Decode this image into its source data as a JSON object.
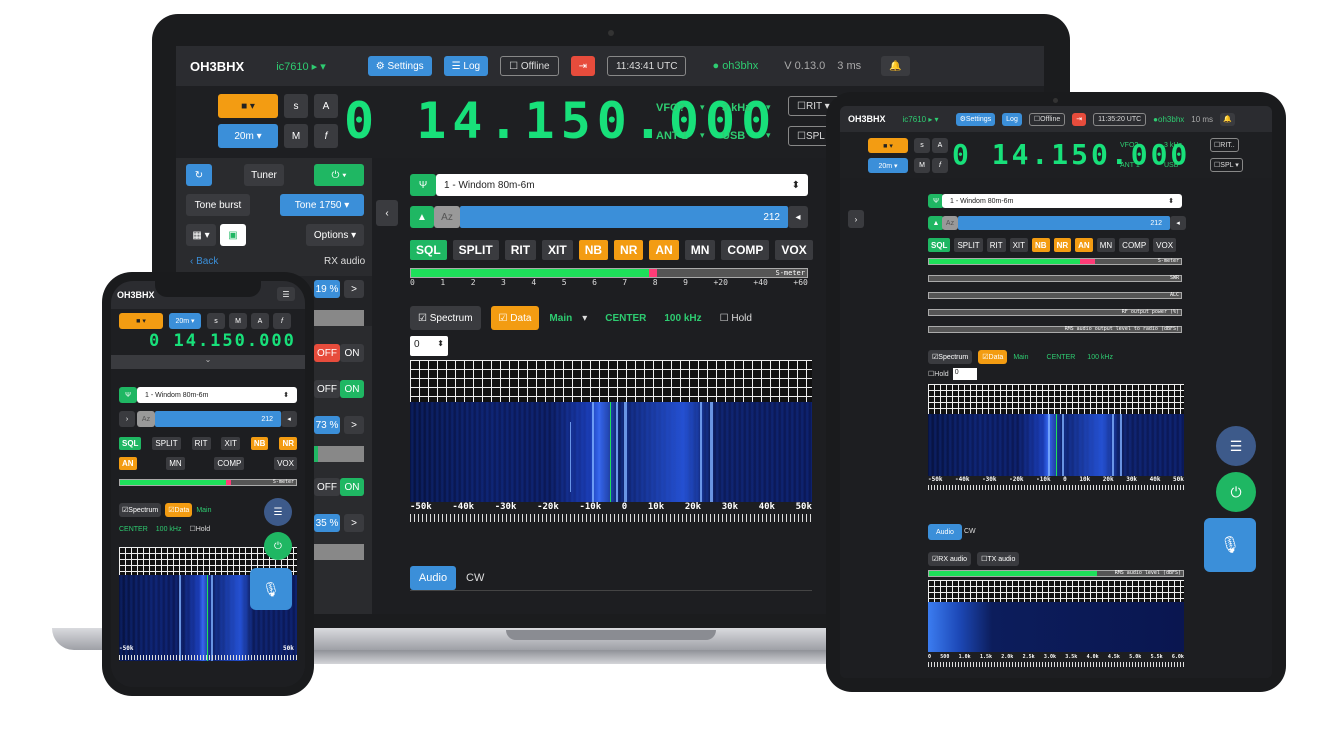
{
  "laptop": {
    "topbar": {
      "brand": "OH3BHX",
      "radio": "ic7610 ▸ ▾",
      "settings": "Settings",
      "log": "Log",
      "offline": "Offline",
      "logout_icon": "sign-out-icon",
      "time": "11:43:41 UTC",
      "user": "oh3bhx",
      "version": "V 0.13.0",
      "latency": "3 ms"
    },
    "freqrow": {
      "a_label": "A",
      "s_label": "s",
      "m_label": "M",
      "f_label": "f",
      "band": "20m ▾",
      "frequency": "0 14.150.000",
      "vfo": "VFO?",
      "ant": "ANT 1",
      "bw": "3 kHz",
      "mode": "USB",
      "rit": "RIT ▾",
      "spl": "SPL ▾"
    },
    "left": {
      "tuner": "Tuner",
      "tone_burst": "Tone burst",
      "tone": "Tone 1750",
      "options": "Options ▾",
      "back": "‹ Back",
      "rx_audio": "RX audio",
      "pct1": "19 %",
      "pct2": "73 %",
      "pct3": "35 %",
      "off": "OFF",
      "on": "ON",
      "gt": ">"
    },
    "main": {
      "antenna": "1 - Windom 80m-6m",
      "az": "Az",
      "az_value": "212",
      "buttons": [
        "SQL",
        "SPLIT",
        "RIT",
        "XIT",
        "NB",
        "NR",
        "AN",
        "MN",
        "COMP",
        "VOX"
      ],
      "s_meter": "S-meter",
      "s_scale": [
        "0",
        "1",
        "2",
        "3",
        "4",
        "5",
        "6",
        "7",
        "8",
        "9",
        "+20",
        "+40",
        "+60"
      ],
      "spectrum": "Spectrum",
      "data": "Data",
      "main_sel": "Main",
      "center": "CENTER",
      "span": "100 kHz",
      "hold": "Hold",
      "ref_value": "0",
      "axis": [
        "-50k",
        "-40k",
        "-30k",
        "-20k",
        "-10k",
        "0",
        "10k",
        "20k",
        "30k",
        "40k",
        "50k"
      ],
      "tab_audio": "Audio",
      "tab_cw": "CW"
    }
  },
  "tablet": {
    "brand": "OH3BHX",
    "radio": "ic7610 ▸ ▾",
    "settings": "Settings",
    "log": "Log",
    "offline": "Offline",
    "time": "11:35:20 UTC",
    "user": "oh3bhx",
    "latency": "10 ms",
    "frequency": "0 14.150.000",
    "vfo": "VFO?",
    "ant": "ANT 1",
    "bw": "3 kHz",
    "mode": "USB",
    "rit": "RIT..",
    "spl": "SPL ▾",
    "band": "20m ▾",
    "antenna": "1 - Windom 80m-6m",
    "az": "Az",
    "az_value": "212",
    "buttons": [
      "SQL",
      "SPLIT",
      "RIT",
      "XIT",
      "NB",
      "NR",
      "AN",
      "MN",
      "COMP",
      "VOX"
    ],
    "meter_labels": [
      "S-meter",
      "SWR",
      "ALC",
      "RF output power (%)",
      "RMS audio output level to radio (dBFS)"
    ],
    "spectrum": "Spectrum",
    "data": "Data",
    "main_sel": "Main",
    "center": "CENTER",
    "span": "100 kHz",
    "hold": "Hold",
    "ref_value": "0",
    "axis": [
      "-50k",
      "-40k",
      "-30k",
      "-20k",
      "-10k",
      "0",
      "10k",
      "20k",
      "30k",
      "40k",
      "50k"
    ],
    "tab_audio": "Audio",
    "tab_cw": "CW",
    "rx_audio": "RX audio",
    "tx_audio": "TX audio",
    "rms_label": "RMS audio level (dBFS)",
    "audio_axis": [
      "0",
      "500",
      "1.0k",
      "1.5k",
      "2.0k",
      "2.5k",
      "3.0k",
      "3.5k",
      "4.0k",
      "4.5k",
      "5.0k",
      "5.5k",
      "6.0k"
    ]
  },
  "phone": {
    "brand": "OH3BHX",
    "band": "20m ▾",
    "s": "s",
    "m": "M",
    "a": "A",
    "f": "f",
    "frequency": "0 14.150.000",
    "antenna": "1 - Windom 80m-6m",
    "az": "Az",
    "az_value": "212",
    "row1": [
      "SQL",
      "SPLIT",
      "RIT",
      "XIT",
      "NB",
      "NR"
    ],
    "row2": [
      "AN",
      "MN",
      "COMP",
      "VOX"
    ],
    "s_meter": "S-meter",
    "spectrum": "Spectrum",
    "data": "Data",
    "main_sel": "Main",
    "center": "CENTER",
    "span": "100 kHz",
    "hold": "Hold",
    "axis_left": "-50k",
    "axis_right": "50k"
  }
}
